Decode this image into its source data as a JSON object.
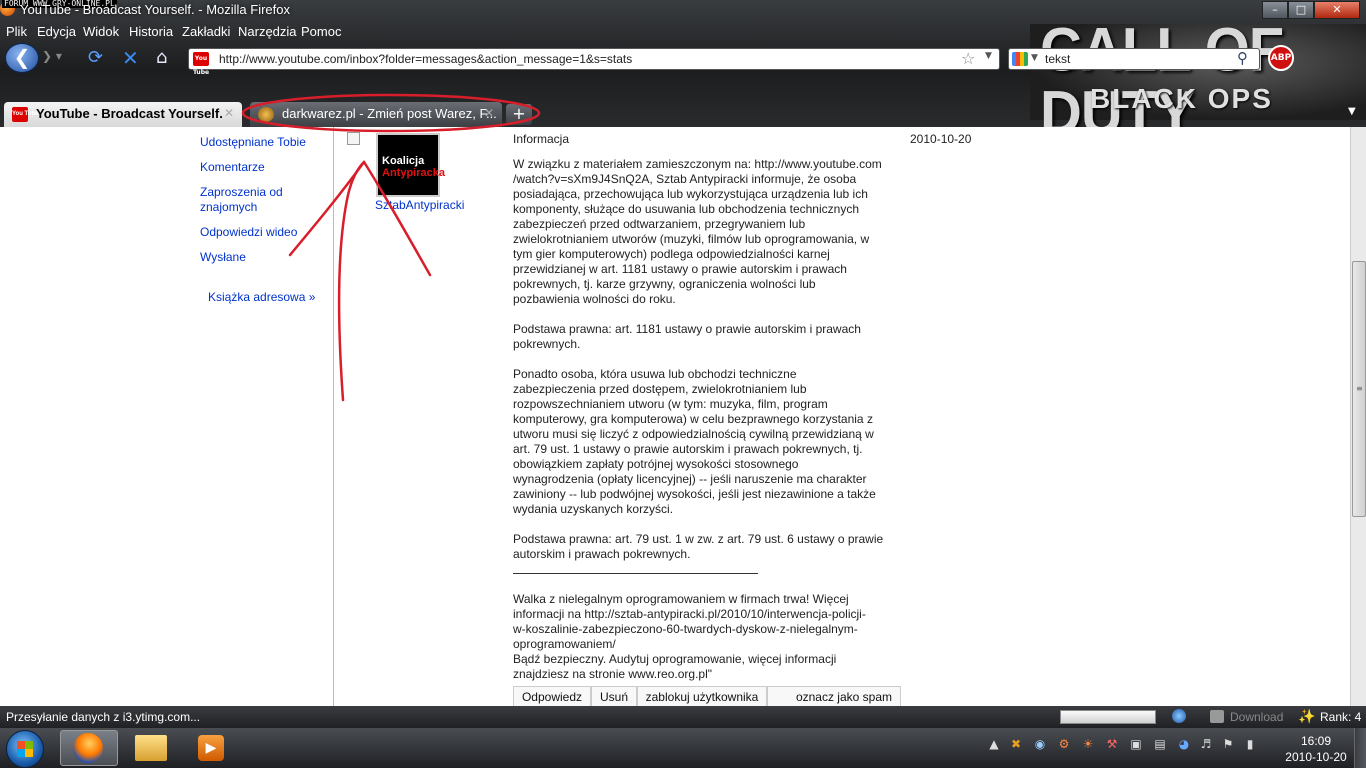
{
  "window": {
    "title": "YouTube - Broadcast Yourself. - Mozilla Firefox",
    "watermark": "FORUM WWW.GRY-ONLINE.PL",
    "min": "–",
    "max": "□",
    "close": "✕"
  },
  "menu": [
    "Plik",
    "Edycja",
    "Widok",
    "Historia",
    "Zakładki",
    "Narzędzia",
    "Pomoc"
  ],
  "nav": {
    "url": "http://www.youtube.com/inbox?folder=messages&action_message=1&s=stats",
    "search_value": "tekst",
    "yt_badge": "You Tube",
    "abp": "ABP"
  },
  "banner": {
    "line1": "CALL OF DUTY",
    "line2": "BLACK OPS"
  },
  "tabs": [
    {
      "label": "YouTube - Broadcast Yourself.",
      "active": true
    },
    {
      "label": "darkwarez.pl - Zmień post Warez, F...",
      "active": false
    }
  ],
  "sidebar": {
    "items": [
      "Udostępniane Tobie",
      "Komentarze",
      "Zaproszenia od znajomych",
      "Odpowiedzi wideo",
      "Wysłane"
    ],
    "address_book": "Książka adresowa »"
  },
  "message": {
    "avatar_line1": "Koalicja",
    "avatar_line2": "Antypiracka",
    "sender": "SztabAntypiracki",
    "subject": "Informacja",
    "date": "2010-10-20",
    "body": "W związku z materiałem zamieszczonym na: http://www.youtube.com\n/watch?v=sXm9J4SnQ2A, Sztab Antypiracki informuje, że osoba\nposiadająca, przechowująca lub wykorzystująca urządzenia lub ich\nkomponenty, służące do usuwania lub obchodzenia technicznych\nzabezpieczeń przed odtwarzaniem, przegrywaniem lub\nzwielokrotnianiem utworów (muzyki, filmów lub oprogramowania, w\ntym gier komputerowych) podlega odpowiedzialności karnej\nprzewidzianej w art. 1181 ustawy o prawie autorskim i prawach\npokrewnych, tj. karze grzywny, ograniczenia wolności lub\npozbawienia wolności do roku.\n\nPodstawa prawna: art. 1181 ustawy o prawie autorskim i prawach\npokrewnych.\n\nPonadto osoba, która usuwa lub obchodzi techniczne\nzabezpieczenia przed dostępem, zwielokrotnianiem lub\nrozpowszechnianiem utworu (w tym: muzyka, film, program\nkomputerowy, gra komputerowa) w celu bezprawnego korzystania z\nutworu musi się liczyć z odpowiedzialnością cywilną przewidzianą w\nart. 79 ust. 1 ustawy o prawie autorskim i prawach pokrewnych, tj.\nobowiązkiem zapłaty potrójnej wysokości stosownego\nwynagrodzenia (opłaty licencyjnej) -- jeśli naruszenie ma charakter\nzawiniony -- lub podwójnej wysokości, jeśli jest niezawinione a także\nwydania uzyskanych korzyści.\n\nPodstawa prawna: art. 79 ust. 1 w zw. z art. 79 ust. 6 ustawy o prawie\nautorskim i prawach pokrewnych.\n\n\nWalka z nielegalnym oprogramowaniem w firmach trwa! Więcej\ninformacji na http://sztab-antypiracki.pl/2010/10/interwencja-policji-\nw-koszalinie-zabezpieczono-60-twardych-dyskow-z-nielegalnym-\noprogramowaniem/\nBądź bezpieczny. Audytuj oprogramowanie, więcej informacji\nznajdziesz na stronie www.reo.org.pl\"",
    "actions": [
      "Odpowiedz",
      "Usuń",
      "zablokuj użytkownika",
      "oznacz jako spam"
    ]
  },
  "status": {
    "text": "Przesyłanie danych z i3.ytimg.com...",
    "download": "Download",
    "rank": "Rank: 4"
  },
  "taskbar": {
    "time": "16:09",
    "date": "2010-10-20"
  },
  "colors": {
    "link": "#0033cc",
    "annotation": "#d81e2a"
  }
}
